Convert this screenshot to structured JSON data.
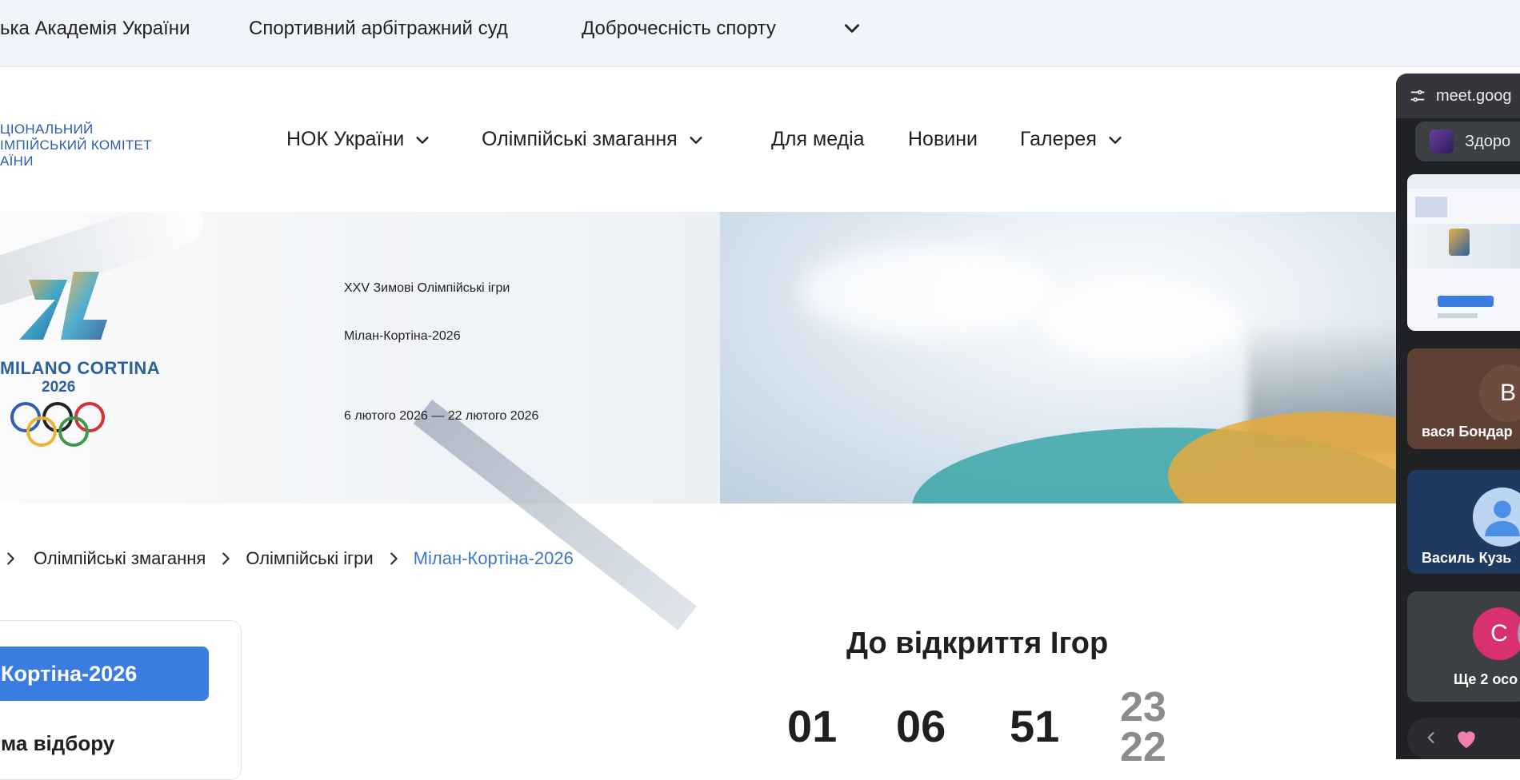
{
  "topbar": {
    "links": [
      "ька Академія України",
      "Спортивний арбітражний суд",
      "Доброчесність спорту"
    ]
  },
  "header": {
    "logo_lines": [
      "ЦІОНАЛЬНИЙ",
      "ІМПІЙСЬКИЙ КОМІТЕТ",
      "АЇНИ"
    ],
    "nav": [
      {
        "label": "НОК України",
        "has_dropdown": true
      },
      {
        "label": "Олімпійські змагання",
        "has_dropdown": true
      },
      {
        "label": "Для медіа",
        "has_dropdown": false
      },
      {
        "label": "Новини",
        "has_dropdown": false
      },
      {
        "label": "Галерея",
        "has_dropdown": true
      }
    ]
  },
  "hero": {
    "subtitle": "XXV Зимові Олімпійські ігри",
    "title": "Мілан-Кортіна-2026",
    "dates": "6 лютого 2026 — 22 лютого 2026",
    "emblem_text": "MILANO CORTINA",
    "emblem_year": "2026",
    "emblem_mark": "26"
  },
  "breadcrumb": {
    "items": [
      "Олімпійські змагання",
      "Олімпійські ігри"
    ],
    "current": "Мілан-Кортіна-2026"
  },
  "sidebar": {
    "active_label": "Кортіна-2026",
    "second_label": "ма відбору"
  },
  "countdown": {
    "title": "До відкриття Ігор",
    "days": "01",
    "hours": "06",
    "minutes": "51",
    "seconds_prev": "23",
    "seconds_next": "22"
  },
  "meet": {
    "url": "meet.goog",
    "chip_label": "Здоро",
    "participants": [
      {
        "initial": "В",
        "name": "вася Бондар",
        "color": "#5f4034"
      },
      {
        "initial": "",
        "name": "Василь Кузь",
        "color": "#1e3a5f"
      },
      {
        "initial": "С",
        "name": "Ще 2 осо",
        "color": "#d93072"
      }
    ]
  },
  "colors": {
    "accent": "#3a7ce0",
    "breadcrumb_current": "#3d78c8",
    "meet_bg": "#202124"
  }
}
